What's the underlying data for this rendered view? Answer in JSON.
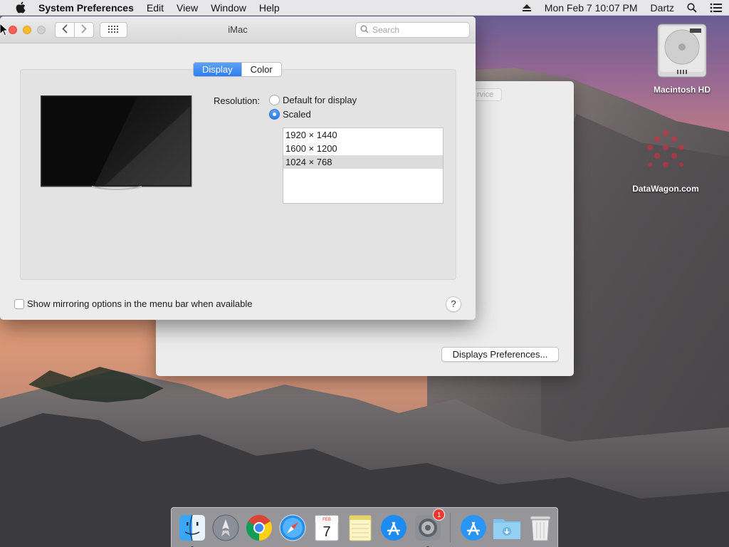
{
  "menubar": {
    "app_name": "System Preferences",
    "items": [
      "Edit",
      "View",
      "Window",
      "Help"
    ],
    "clock": "Mon Feb 7  10:07 PM",
    "user": "Dartz"
  },
  "desktop": {
    "icons": [
      {
        "label": "Macintosh HD",
        "icon": "hard-drive-icon"
      },
      {
        "label": "DataWagon.com",
        "icon": "datawagon-logo-icon"
      }
    ]
  },
  "background_window": {
    "service_button": "rvice",
    "displays_preferences_button": "Displays Preferences..."
  },
  "window": {
    "title": "iMac",
    "search_placeholder": "Search",
    "tabs": [
      {
        "label": "Display",
        "active": true
      },
      {
        "label": "Color",
        "active": false
      }
    ],
    "resolution_label": "Resolution:",
    "options": [
      {
        "label": "Default for display",
        "selected": false
      },
      {
        "label": "Scaled",
        "selected": true
      }
    ],
    "resolutions": [
      {
        "label": "1920 × 1440",
        "selected": false
      },
      {
        "label": "1600 × 1200",
        "selected": false
      },
      {
        "label": "1024 × 768",
        "selected": true
      }
    ],
    "mirror_label": "Show mirroring options in the menu bar when available",
    "mirror_checked": false,
    "help_label": "?"
  },
  "dock": {
    "items": [
      {
        "name": "finder-icon",
        "running": true
      },
      {
        "name": "launchpad-icon",
        "running": false
      },
      {
        "name": "chrome-icon",
        "running": false
      },
      {
        "name": "safari-icon",
        "running": false
      },
      {
        "name": "calendar-icon",
        "running": false,
        "month": "FEB",
        "day": "7"
      },
      {
        "name": "notes-icon",
        "running": false
      },
      {
        "name": "app-store-icon",
        "running": false
      },
      {
        "name": "system-preferences-icon",
        "running": true,
        "badge": "1"
      },
      {
        "name": "app-store-folder-icon",
        "running": false
      },
      {
        "name": "downloads-folder-icon",
        "running": false
      },
      {
        "name": "trash-icon",
        "running": false
      }
    ]
  },
  "colors": {
    "accent": "#2b7ff3",
    "close": "#fc5f57",
    "minimize": "#fdbc2e",
    "badge": "#f2362c"
  }
}
